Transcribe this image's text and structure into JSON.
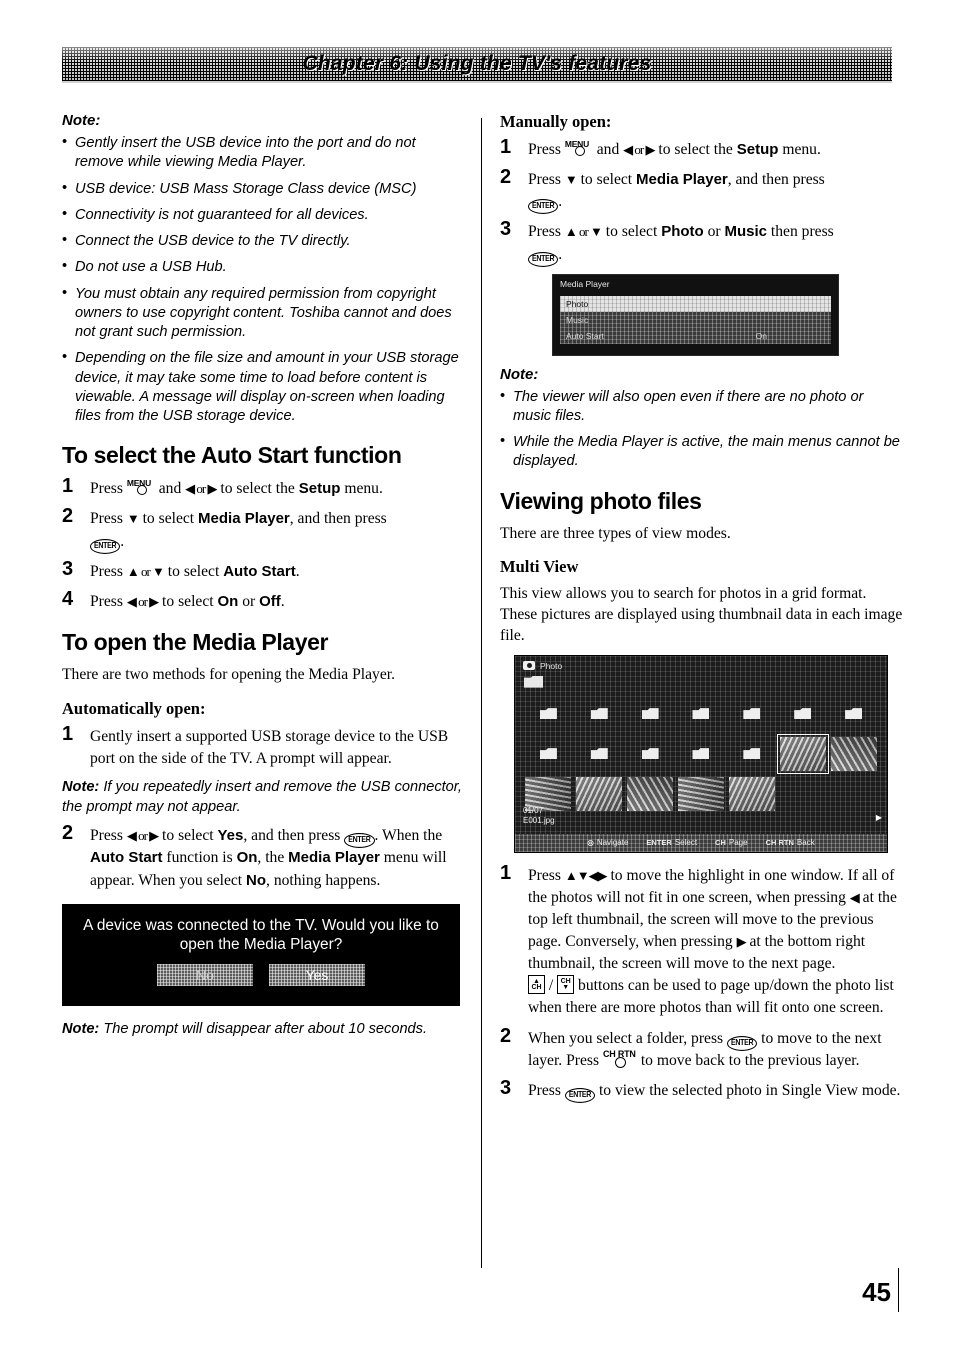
{
  "header": {
    "chapter_title": "Chapter 6: Using the TV's features"
  },
  "page_number": "45",
  "left_column": {
    "note_label": "Note:",
    "note_bullets": [
      "Gently insert the USB device into the port and do not remove while viewing Media Player.",
      "USB device: USB Mass Storage Class device (MSC)",
      "Connectivity is not guaranteed for all devices.",
      "Connect the USB device to the TV directly.",
      "Do not use a USB Hub.",
      "You must obtain any required permission from copyright owners to use copyright content. Toshiba cannot and does not grant such permission.",
      "Depending on the file size and amount in your USB storage device, it may take some time to load before content is viewable. A message will display on-screen when loading files from the USB storage device."
    ],
    "auto_start_heading": "To select the Auto Start function",
    "auto_start_steps": [
      {
        "num": "1",
        "pre": "Press ",
        "key": "MENU",
        "mid": " and ",
        "arrows": "◀ or ▶",
        "post": " to select the ",
        "bold": "Setup",
        "tail": " menu."
      },
      {
        "num": "2",
        "pre": "Press ",
        "arrows": "▼",
        "post": " to select ",
        "bold": "Media Player",
        "tail": ", and then press "
      },
      {
        "num": "3",
        "pre": "Press ",
        "arrows": "▲ or ▼",
        "post": " to select ",
        "bold": "Auto Start",
        "tail": "."
      },
      {
        "num": "4",
        "pre": "Press ",
        "arrows": "◀ or ▶",
        "post": " to select ",
        "bold": "On",
        "mid2": " or ",
        "bold2": "Off",
        "tail": "."
      }
    ],
    "open_heading": "To open the Media Player",
    "open_intro": "There are two methods for opening the Media Player.",
    "auto_open_subhead": "Automatically open:",
    "auto_open_step1_num": "1",
    "auto_open_step1": "Gently insert a supported USB storage device to the USB port on the side of the TV. A prompt will appear.",
    "note_inline_label": "Note:",
    "note_inline_text": " If you repeatedly insert and remove the USB connector, the prompt may not appear.",
    "auto_open_step2_num": "2",
    "auto_open_step2": {
      "a": "Press ",
      "arrows": "◀ or ▶",
      "b": " to select ",
      "yes": "Yes",
      "c": ", and then press ",
      "d": "When the ",
      "autostart": "Auto Start",
      "e": " function is ",
      "on": "On",
      "f": ", the ",
      "mediaplayer": "Media Player",
      "g": " menu will appear. When you select ",
      "no": "No",
      "h": ", nothing happens."
    },
    "prompt_dialog": {
      "message": "A device was connected to the TV. Would you like to open the Media Player?",
      "button_no": "No",
      "button_yes": "Yes"
    },
    "note_bottom_label": "Note:",
    "note_bottom_text": " The prompt will disappear after about 10 seconds."
  },
  "right_column": {
    "manual_subhead": "Manually open:",
    "manual_steps": [
      {
        "num": "1",
        "pre": "Press ",
        "key": "MENU",
        "mid": " and ",
        "arrows": "◀ or ▶",
        "post": " to select the ",
        "bold": "Setup",
        "tail": " menu."
      },
      {
        "num": "2",
        "pre": "Press ",
        "arrows": "▼",
        "post": " to select ",
        "bold": "Media Player",
        "tail": ", and then press "
      },
      {
        "num": "3",
        "pre": "Press ",
        "arrows": "▲ or ▼",
        "post": " to select ",
        "bold": "Photo",
        "mid2": " or ",
        "bold2": "Music",
        "tail": " then press "
      }
    ],
    "media_player_screen": {
      "title": "Media Player",
      "rows": [
        {
          "label": "Photo",
          "value": "",
          "selected": true
        },
        {
          "label": "Music",
          "value": "",
          "selected": false
        },
        {
          "label": "Auto Start",
          "value": "On",
          "selected": false
        }
      ]
    },
    "note_label": "Note:",
    "note_bullets": [
      "The viewer will also open even if there are no photo or music files.",
      "While the Media Player is active, the main menus cannot be displayed."
    ],
    "viewing_heading": "Viewing photo files",
    "viewing_intro": "There are three types of view modes.",
    "multi_view_subhead": "Multi View",
    "multi_view_text": "This view allows you to search for photos in a grid format. These pictures are displayed using thumbnail data in each image file.",
    "photo_screen": {
      "title": "Photo",
      "file_index": "01/07",
      "file_name": "E001.jpg",
      "legend": [
        {
          "key": "",
          "label": "Navigate"
        },
        {
          "key": "ENTER",
          "label": "Select"
        },
        {
          "key": "CH",
          "label": "Page"
        },
        {
          "key": "CH RTN",
          "label": "Back"
        }
      ]
    },
    "grid_steps": [
      {
        "num": "1",
        "a": "Press ",
        "arrows": "▲▼◀▶",
        "b": " to move the highlight in one window. If all of the photos will not fit in one screen, when pressing ",
        "arrow2": "◀",
        "c": " at the top left thumbnail, the screen will move to the previous page. Conversely, when pressing ",
        "arrow3": "▶",
        "d": " at the bottom right thumbnail, the screen will move to the next page.",
        "e": " buttons can be used to page up/down the photo list when there are more photos than will fit onto one screen.",
        "ch_up": "CH",
        "ch_down": "CH",
        "slash": "/"
      },
      {
        "num": "2",
        "a": "When you select a folder, press ",
        "b": " to move to the next layer. Press ",
        "key": "CH RTN",
        "c": " to move back to the previous layer."
      },
      {
        "num": "3",
        "a": "Press ",
        "b": " to view the selected photo in Single View mode."
      }
    ]
  }
}
